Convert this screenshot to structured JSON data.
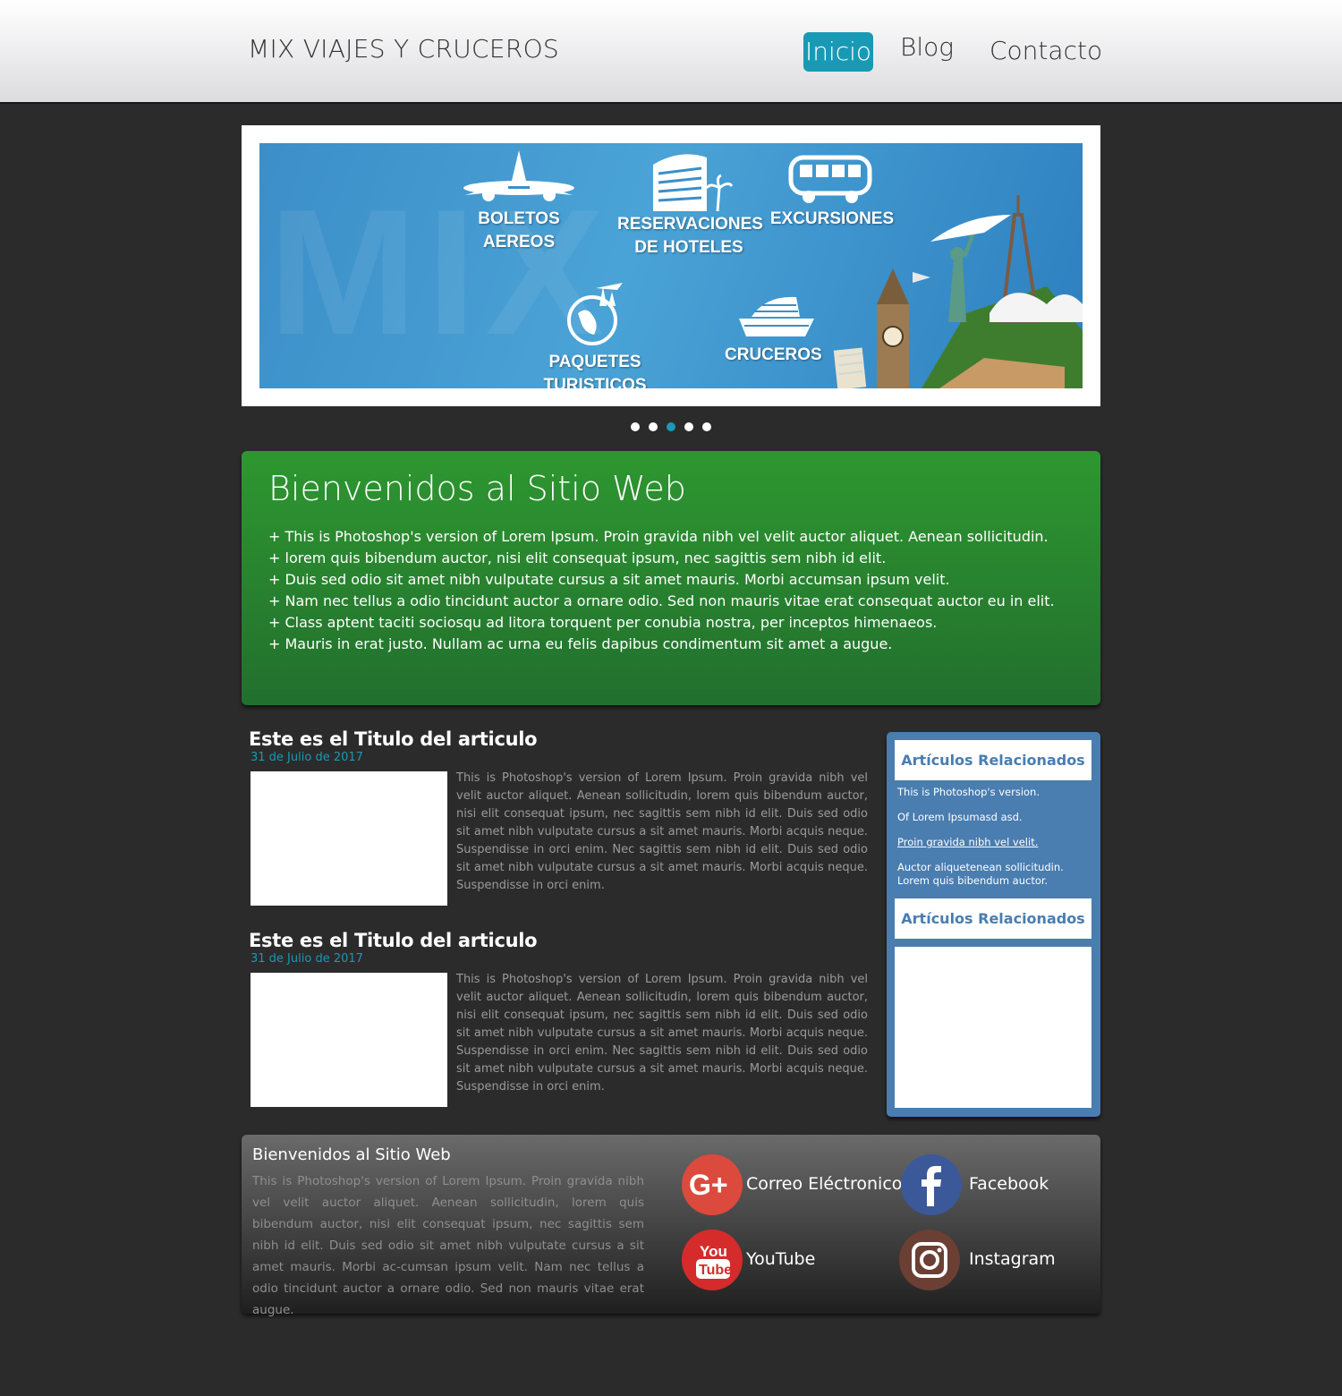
{
  "header": {
    "logo": "MIX VIAJES Y CRUCEROS",
    "nav": [
      "Inicio",
      "Blog",
      "Contacto"
    ],
    "active_color": "#1a99b4"
  },
  "slider": {
    "labels": {
      "flights": "BOLETOS AEREOS",
      "hotels_1": "RESERVACIONES",
      "hotels_2": "DE HOTELES",
      "excursions": "EXCURSIONES",
      "packages": "PAQUETES TURISTICOS",
      "cruises": "CRUCEROS"
    },
    "watermark": "MIX",
    "dots": 5,
    "active_dot": 3
  },
  "welcome": {
    "title": "Bienvenidos al Sitio Web",
    "items": [
      "+ This is Photoshop's version  of Lorem Ipsum. Proin gravida nibh vel velit auctor aliquet. Aenean sollicitudin.",
      "+ lorem quis bibendum auctor, nisi elit consequat ipsum, nec sagittis sem nibh id elit.",
      "+ Duis sed odio sit amet nibh vulputate cursus a sit amet mauris. Morbi accumsan ipsum velit.",
      "+ Nam nec tellus a odio tincidunt auctor a ornare odio. Sed non  mauris vitae erat consequat auctor eu in elit.",
      "+ Class aptent taciti sociosqu ad litora torquent per conubia nostra, per inceptos himenaeos.",
      "+ Mauris in erat justo. Nullam ac urna eu felis dapibus condimentum sit amet a augue."
    ],
    "color": "#2e9730"
  },
  "articles": [
    {
      "title": "Este es el Titulo del articulo",
      "date": "31 de Julio de 2017",
      "text": "This is Photoshop's version  of Lorem Ipsum. Proin gravida nibh vel velit auctor aliquet. Aenean sollicitudin, lorem quis bibendum auctor, nisi elit consequat ipsum, nec sagittis sem nibh id elit. Duis sed odio sit amet nibh vulputate cursus a sit amet mauris. Morbi acquis neque. Suspendisse in orci enim. Nec sagittis sem nibh id elit. Duis sed odio sit amet nibh vulputate cursus a sit amet mauris. Morbi acquis neque. Suspendisse in orci enim."
    },
    {
      "title": "Este es el Titulo del articulo",
      "date": "31 de Julio de 2017",
      "text": "This is Photoshop's version  of Lorem Ipsum. Proin gravida nibh vel velit auctor aliquet. Aenean sollicitudin, lorem quis bibendum auctor, nisi elit consequat ipsum, nec sagittis sem nibh id elit. Duis sed odio sit amet nibh vulputate cursus a sit amet mauris. Morbi acquis neque. Suspendisse in orci enim. Nec sagittis sem nibh id elit. Duis sed odio sit amet nibh vulputate cursus a sit amet mauris. Morbi acquis neque. Suspendisse in orci enim."
    }
  ],
  "sidebar": {
    "heading_1": "Artículos Relacionados",
    "heading_2": "Artículos Relacionados",
    "links": [
      "This is Photoshop's version.",
      "Of Lorem Ipsumasd asd.",
      "Proin gravida nibh vel velit.",
      "Auctor aliquetenean sollicitudin. Lorem quis bibendum auctor."
    ],
    "color": "#4a7db0"
  },
  "footer": {
    "title": "Bienvenidos al Sitio Web",
    "text": "This is Photoshop's version  of Lorem Ipsum. Proin gravida nibh vel velit auctor aliquet. Aenean sollicitudin, lorem quis bibendum auctor, nisi elit consequat ipsum, nec sagittis sem nibh id elit. Duis sed odio sit amet nibh vulputate cursus a sit amet mauris. Morbi ac-cumsan ipsum velit. Nam nec tellus a odio tincidunt auctor a ornare odio. Sed non  mauris vitae erat augue.",
    "social": {
      "gplus": {
        "label": "Correo Eléctronico",
        "icon": "google-plus-icon",
        "color": "#dc4a3d"
      },
      "facebook": {
        "label": "Facebook",
        "icon": "facebook-icon",
        "color": "#3b5998"
      },
      "youtube": {
        "label": "YouTube",
        "icon": "youtube-icon",
        "color": "#d62b2b",
        "glyph_1": "You",
        "glyph_2": "Tube"
      },
      "instagram": {
        "label": "Instagram",
        "icon": "instagram-icon",
        "color": "#6b3f33"
      }
    }
  }
}
